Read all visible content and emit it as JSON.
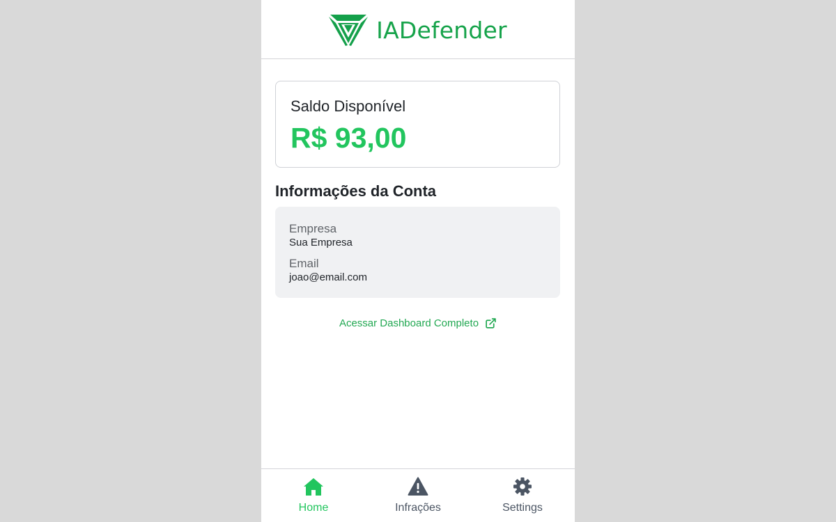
{
  "brand": {
    "name": "IADefender",
    "color": "#16a34a",
    "icon": "shield-logo-icon"
  },
  "balance": {
    "label": "Saldo Disponível",
    "value": "R$ 93,00",
    "color": "#22c55e"
  },
  "account": {
    "title": "Informações da Conta",
    "fields": [
      {
        "label": "Empresa",
        "value": "Sua Empresa"
      },
      {
        "label": "Email",
        "value": "joao@email.com"
      }
    ]
  },
  "dashboard_link": {
    "label": "Acessar Dashboard Completo",
    "icon": "external-link-icon"
  },
  "nav": {
    "items": [
      {
        "label": "Home",
        "icon": "home-icon",
        "active": true
      },
      {
        "label": "Infrações",
        "icon": "warning-icon",
        "active": false
      },
      {
        "label": "Settings",
        "icon": "gear-icon",
        "active": false
      }
    ],
    "active_color": "#22c55e",
    "inactive_color": "#4b5563"
  }
}
